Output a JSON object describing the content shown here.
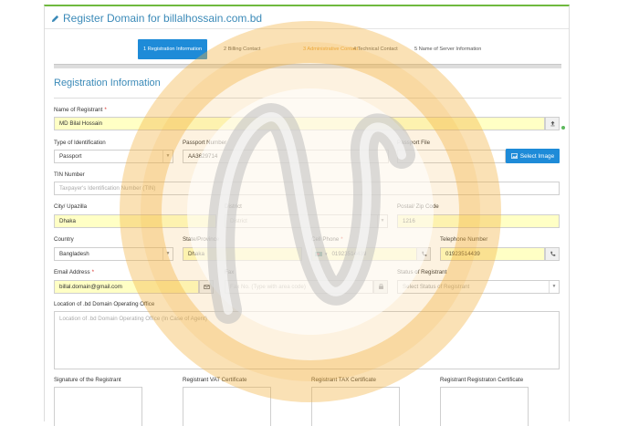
{
  "page": {
    "title": "Register Domain for billalhossain.com.bd",
    "section_title": "Registration Information"
  },
  "steps": [
    {
      "num": "1",
      "label": "Registration Information",
      "state": "active"
    },
    {
      "num": "2",
      "label": "Billing Contact",
      "state": "normal"
    },
    {
      "num": "3",
      "label": "Administrative Contact",
      "state": "warn"
    },
    {
      "num": "4",
      "label": "Technical Contact",
      "state": "normal"
    },
    {
      "num": "5",
      "label": "Name of Server Information",
      "state": "normal"
    }
  ],
  "form": {
    "registrant_name": {
      "label": "Name of Registrant",
      "value": "MD Bilal Hossain"
    },
    "id_type": {
      "label": "Type of Identification",
      "value": "Passport"
    },
    "passport_number": {
      "label": "Passport Number",
      "value": "AA3629714"
    },
    "passport_file": {
      "label": "Passport File",
      "button": "Select Image"
    },
    "tin": {
      "label": "TIN Number",
      "placeholder": "Taxpayer's Identification Number (TIN)"
    },
    "city": {
      "label": "City/ Upazilla",
      "value": "Dhaka"
    },
    "district": {
      "label": "District",
      "placeholder": "District"
    },
    "postal": {
      "label": "Postal/ Zip Code",
      "value": "1216"
    },
    "country": {
      "label": "Country",
      "value": "Bangladesh"
    },
    "state": {
      "label": "State/Province",
      "value": "Dhaka"
    },
    "cell": {
      "label": "Cell Phone",
      "value": "01923514439"
    },
    "telephone": {
      "label": "Telephone Number",
      "value": "01923514439"
    },
    "email": {
      "label": "Email Address",
      "value": "billal.domain@gmail.com"
    },
    "fax": {
      "label": "Fax",
      "placeholder": "Fax No. (Type with area code)"
    },
    "status": {
      "label": "Status of Registrant",
      "placeholder": "Select Status of Registrant"
    },
    "location": {
      "label": "Location of .bd Domain Operating Office",
      "placeholder": "Location of .bd Domain Operating Office (In Case of Agent)"
    },
    "signature_label": "Signature of the Registrant",
    "vat_label": "Registrant VAT Certificate",
    "tax_label": "Registrant TAX Certificate",
    "reg_cert_label": "Registrant Registraton Certificate",
    "required_mark": "*"
  },
  "colors": {
    "accent": "#1e8bd8",
    "title": "#3b8ab8",
    "highlight": "#ffffc5",
    "required": "#d9322e",
    "top_border": "#6fb93f",
    "watermark_orange": "#f3b13c"
  },
  "icons": [
    "pencil-icon",
    "upload-icon",
    "image-icon",
    "phone-icon",
    "envelope-icon",
    "fax-icon",
    "flag-icon",
    "caret-down-icon",
    "watermark-logo"
  ]
}
